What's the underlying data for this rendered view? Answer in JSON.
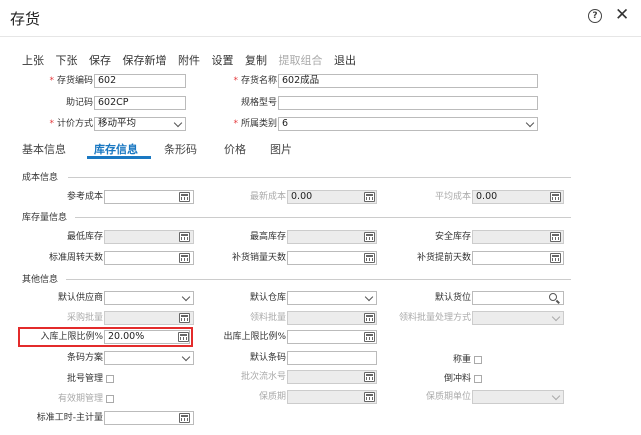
{
  "window": {
    "title": "存货",
    "help": "?",
    "close": "✕"
  },
  "toolbar": [
    "上张",
    "下张",
    "保存",
    "保存新增",
    "附件",
    "设置",
    "复制",
    "提取组合",
    "退出"
  ],
  "header": {
    "code_label": "存货编码",
    "code": "602",
    "name_label": "存货名称",
    "name": "602成品",
    "mnemonic_label": "助记码",
    "mnemonic": "602CP",
    "spec_label": "规格型号",
    "spec": "",
    "pricing_label": "计价方式",
    "pricing": "移动平均",
    "category_label": "所属类别",
    "category": "6"
  },
  "tabs": [
    "基本信息",
    "库存信息",
    "条形码",
    "价格",
    "图片"
  ],
  "sections": {
    "cost": "成本信息",
    "stock": "库存量信息",
    "other": "其他信息"
  },
  "cost": {
    "ref_label": "参考成本",
    "ref": "",
    "latest_label": "最新成本",
    "latest": "0.00",
    "avg_label": "平均成本",
    "avg": "0.00"
  },
  "stock": {
    "min_label": "最低库存",
    "max_label": "最高库存",
    "safe_label": "安全库存",
    "turn_label": "标准周转天数",
    "restock_sales_label": "补货销量天数",
    "restock_ahead_label": "补货提前天数"
  },
  "other": {
    "supplier_label": "默认供应商",
    "warehouse_label": "默认仓库",
    "location_label": "默认货位",
    "purchase_batch_label": "采购批量",
    "pick_batch_label": "领料批量",
    "pick_batch_mode_label": "领料批量处理方式",
    "in_limit_label": "入库上限比例%",
    "in_limit": "20.00%",
    "out_limit_label": "出库上限比例%",
    "out_limit": "",
    "barcode_scheme_label": "条码方案",
    "default_barcode_label": "默认条码",
    "weigh_label": "称重",
    "batch_mgmt_label": "批号管理",
    "batch_serial_label": "批次流水号",
    "backflush_label": "倒冲料",
    "expiry_mgmt_label": "有效期管理",
    "shelf_life_label": "保质期",
    "shelf_unit_label": "保质期单位",
    "std_hours_label": "标准工时-主计量"
  }
}
